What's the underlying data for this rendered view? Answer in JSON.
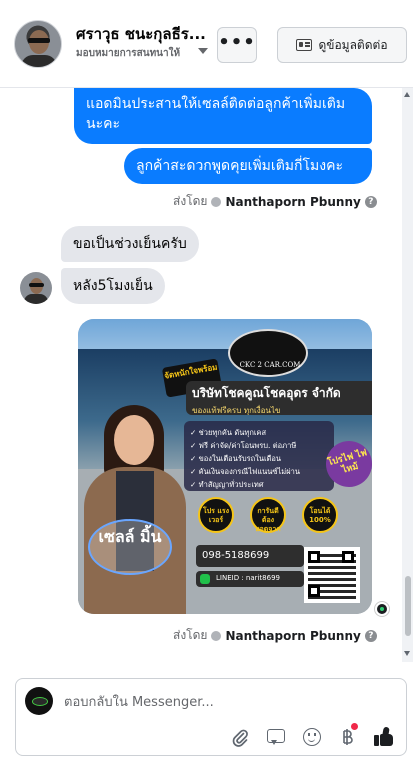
{
  "header": {
    "name": "ศราวุธ ชนะกุลธีร...",
    "assigned": "มอบหมายการสนทนาให้",
    "more_label": "•••",
    "contact_label": "ดูข้อมูลติดต่อ"
  },
  "messages": {
    "out_1": "แอดมินประสานให้เซลล์ติดต่อลูกค้าเพิ่มเติมนะคะ",
    "out_2": "ลูกค้าสะดวกพูดคุยเพิ่มเติมกี่โมงคะ",
    "in_1": "ขอเป็นช่วงเย็นครับ",
    "in_2": "หลัง5โมงเย็น"
  },
  "sent_by": {
    "label": "ส่งโดย",
    "agent": "Nanthaporn Pbunny",
    "help": "?"
  },
  "poster": {
    "logo_text": "CKC 2 CAR.COM",
    "ribbon": "จัดหนักใจพร้อม",
    "company": "บริษัทโชคคูณโชคอุดร จำกัด",
    "tagline": "ของแท้ฟรีครบ ทุกเงื่อนไข",
    "bullets": [
      "✓ ช่วยทุกคัน ดันทุกเคส",
      "✓ ฟรี ค่าจัด/ค่าโอนพรบ. ต่อภาษี",
      "✓ ของในเตือนรับรถในเดือน",
      "✓ คันเงินจองกรณีไฟแนนซ์ไม่ผ่าน",
      "✓ ทำสัญญาทั่วประเทศ"
    ],
    "badges": [
      "โปร แรง เวอร์",
      "การันตี ต้อง ยอดจาก",
      "โอนได้ 100%"
    ],
    "purple_badge": "โปรไฟ ไฟไหม้",
    "phone": "098-5188699",
    "line_id": "LINEID : narit8699",
    "sales_label": "เซลล์ มิ้น"
  },
  "composer": {
    "placeholder": "ตอบกลับใน Messenger..."
  },
  "colors": {
    "outgoing_bubble": "#0a7cff",
    "incoming_bubble": "#e4e6eb",
    "unread_dot": "#f02849"
  },
  "icons": [
    "more-icon",
    "contact-card-icon",
    "chevron-down-icon",
    "attach-icon",
    "quick-reply-icon",
    "emoji-icon",
    "payment-icon",
    "like-icon",
    "help-icon"
  ]
}
